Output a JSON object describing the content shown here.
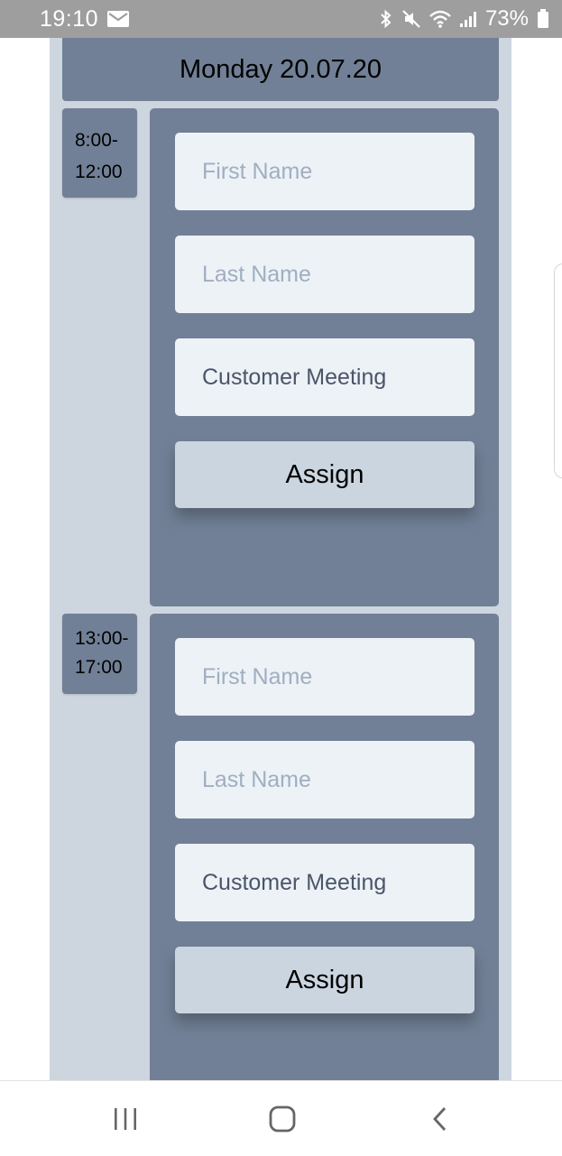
{
  "status_bar": {
    "time": "19:10",
    "notification_icon": "mail-icon",
    "icons": [
      "bluetooth-icon",
      "mute-icon",
      "wifi-icon",
      "signal-icon"
    ],
    "battery": "73%",
    "battery_icon": "battery-icon"
  },
  "schedule": {
    "day": "Monday 20.07.20",
    "slots": [
      {
        "time_start": "8:00-",
        "time_end": "12:00",
        "first_name_placeholder": "First Name",
        "last_name_placeholder": "Last Name",
        "purpose_value": "Customer Meeting",
        "assign_label": "Assign"
      },
      {
        "time_start": "13:00-",
        "time_end": "17:00",
        "first_name_placeholder": "First Name",
        "last_name_placeholder": "Last Name",
        "purpose_value": "Customer Meeting",
        "assign_label": "Assign"
      }
    ]
  },
  "nav_bar": {
    "buttons": [
      "recent-apps-icon",
      "home-icon",
      "back-icon"
    ]
  },
  "colors": {
    "status_bar": "#9e9e9e",
    "page_column": "#cdd5df",
    "card": "#718096",
    "input": "#edf2f7",
    "button": "#cbd5e0"
  }
}
